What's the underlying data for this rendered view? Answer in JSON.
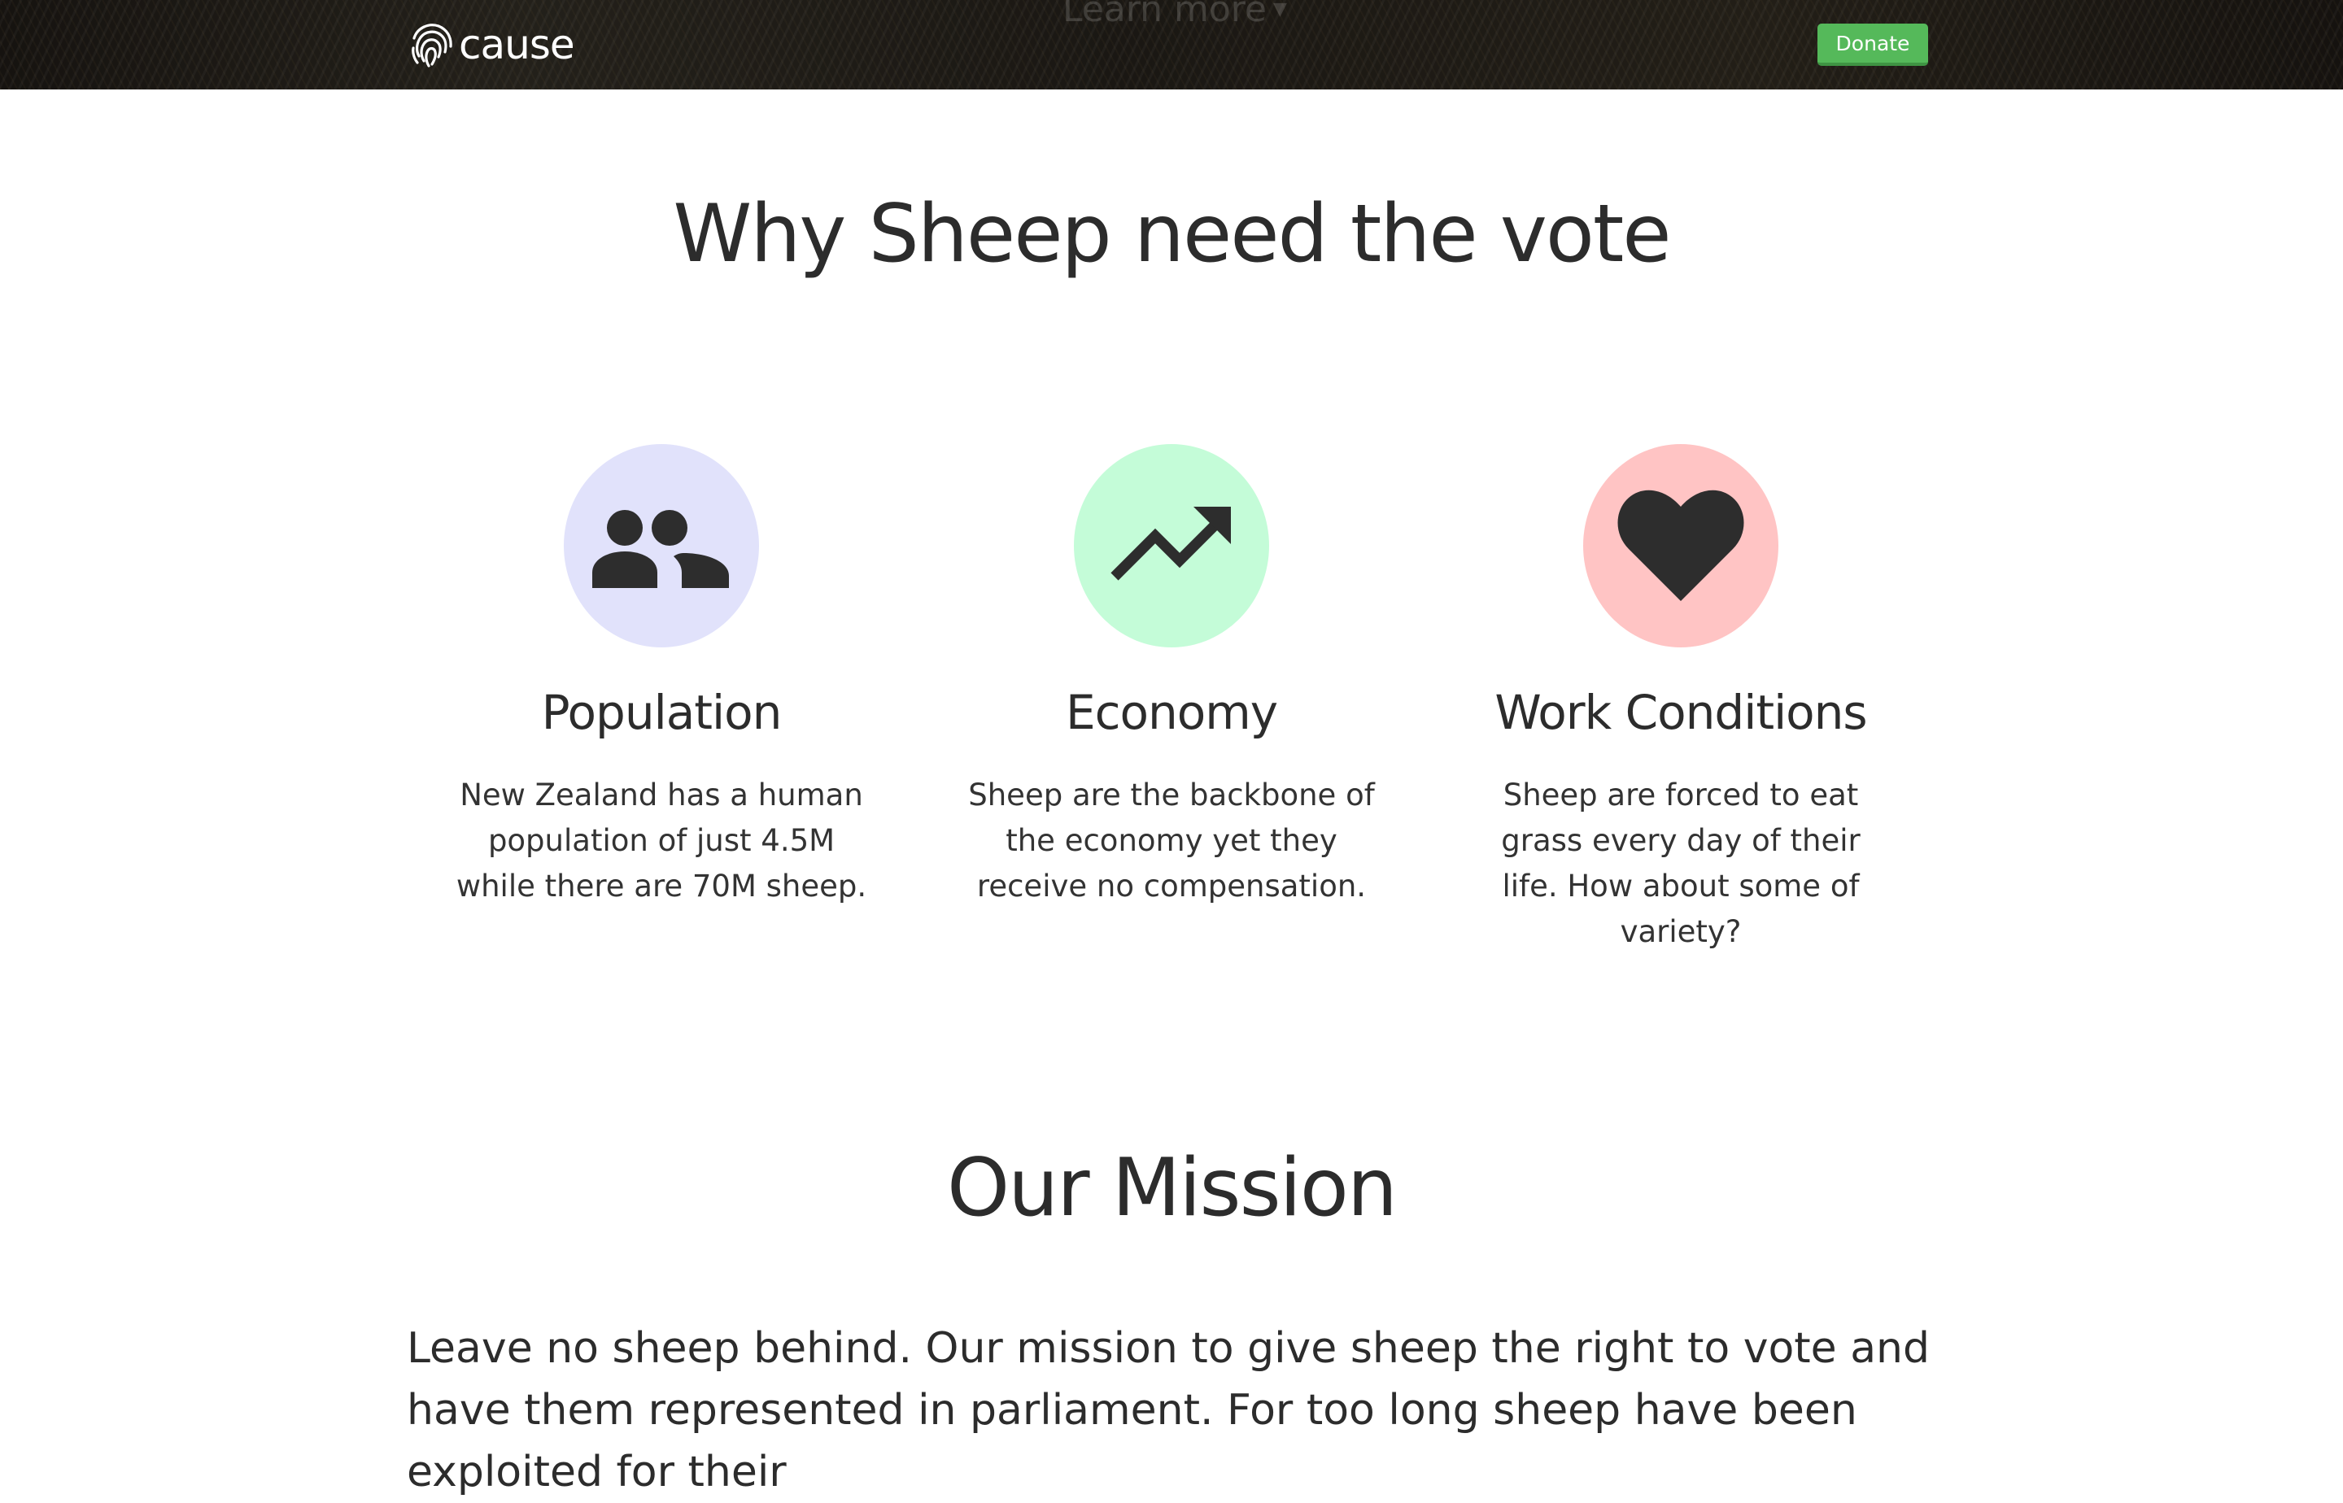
{
  "header": {
    "brand_name": "cause",
    "learn_more_label": "Learn more",
    "donate_label": "Donate",
    "donate_color": "#55b95a"
  },
  "why": {
    "title": "Why Sheep need the vote",
    "features": [
      {
        "icon": "people-icon",
        "color": "#e1e2fb",
        "title": "Population",
        "text": "New Zealand has a human population of just 4.5M while there are 70M sheep."
      },
      {
        "icon": "trending-up-icon",
        "color": "#c4fcd8",
        "title": "Economy",
        "text": "Sheep are the backbone of the economy yet they receive no compensation."
      },
      {
        "icon": "heart-icon",
        "color": "#ffc4c4",
        "title": "Work Conditions",
        "text": "Sheep are forced to eat grass every day of their life. How about some of variety?"
      }
    ]
  },
  "mission": {
    "title": "Our Mission",
    "text": "Leave no sheep behind. Our mission to give sheep the right to vote and have them represented in parliament. For too long sheep have been exploited for their"
  }
}
